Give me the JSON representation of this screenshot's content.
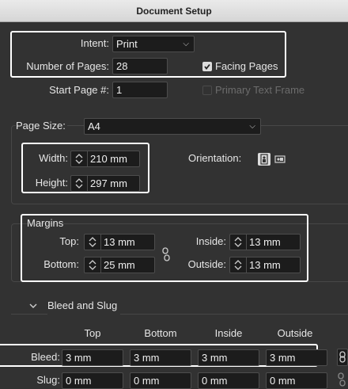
{
  "window": {
    "title": "Document Setup"
  },
  "intent": {
    "label": "Intent:",
    "value": "Print"
  },
  "pages": {
    "label": "Number of Pages:",
    "value": "28"
  },
  "facing_pages": {
    "label": "Facing Pages",
    "checked": true
  },
  "start_page": {
    "label": "Start Page #:",
    "value": "1"
  },
  "primary_text_frame": {
    "label": "Primary Text Frame",
    "checked": false,
    "enabled": false
  },
  "page_size": {
    "label": "Page Size:",
    "value": "A4"
  },
  "width": {
    "label": "Width:",
    "value": "210 mm"
  },
  "height": {
    "label": "Height:",
    "value": "297 mm"
  },
  "orientation": {
    "label": "Orientation:",
    "selected": "portrait"
  },
  "margins": {
    "title": "Margins",
    "top": {
      "label": "Top:",
      "value": "13 mm"
    },
    "bottom": {
      "label": "Bottom:",
      "value": "25 mm"
    },
    "inside": {
      "label": "Inside:",
      "value": "13 mm"
    },
    "outside": {
      "label": "Outside:",
      "value": "13 mm"
    }
  },
  "bleed_slug": {
    "title": "Bleed and Slug",
    "columns": [
      "Top",
      "Bottom",
      "Inside",
      "Outside"
    ],
    "bleed": {
      "label": "Bleed:",
      "values": [
        "3 mm",
        "3 mm",
        "3 mm",
        "3 mm"
      ]
    },
    "slug": {
      "label": "Slug:",
      "values": [
        "0 mm",
        "0 mm",
        "0 mm",
        "0 mm"
      ]
    }
  },
  "icons": [
    "chevron-down-icon",
    "checkmark-icon",
    "stepper-icon",
    "portrait-icon",
    "landscape-icon",
    "link-icon",
    "chain-broken-icon"
  ]
}
